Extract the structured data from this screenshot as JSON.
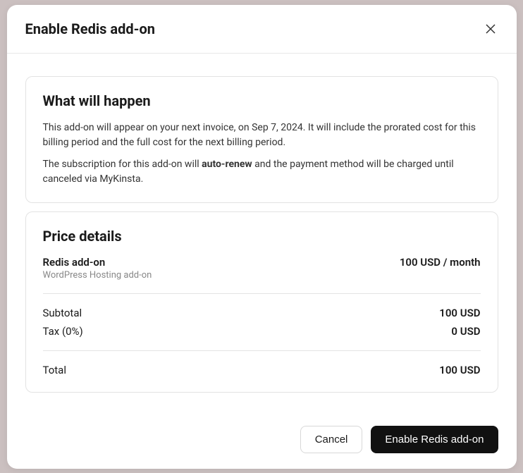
{
  "modal": {
    "title": "Enable Redis add-on"
  },
  "what_will_happen": {
    "title": "What will happen",
    "line1": "This add-on will appear on your next invoice, on Sep 7, 2024. It will include the prorated cost for this billing period and the full cost for the next billing period.",
    "line2_pre": "The subscription for this add-on will ",
    "line2_bold": "auto-renew",
    "line2_post": " and the payment method will be charged until canceled via MyKinsta."
  },
  "price_details": {
    "title": "Price details",
    "item_name": "Redis add-on",
    "item_sub": "WordPress Hosting add-on",
    "item_price": "100 USD / month",
    "subtotal_label": "Subtotal",
    "subtotal_value": "100 USD",
    "tax_label": "Tax (0%)",
    "tax_value": "0 USD",
    "total_label": "Total",
    "total_value": "100 USD"
  },
  "footer": {
    "cancel": "Cancel",
    "confirm": "Enable Redis add-on"
  }
}
